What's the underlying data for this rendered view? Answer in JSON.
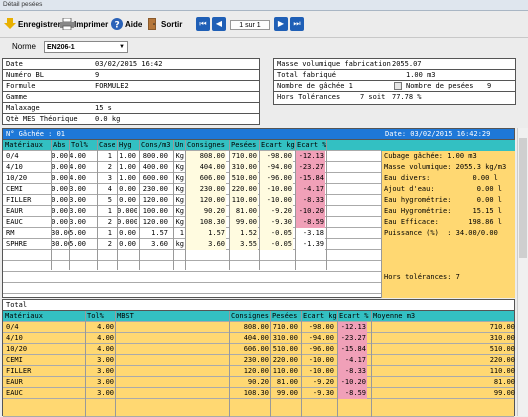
{
  "window": {
    "title": "Détail pesées"
  },
  "toolbar": {
    "save": "Enregistrer",
    "print": "Imprimer",
    "help": "Aide",
    "exit": "Sortir",
    "page": "1 sur 1"
  },
  "form": {
    "label": "Norme",
    "value": "EN206-1"
  },
  "info_left": [
    [
      "Date",
      "03/02/2015 16:42"
    ],
    [
      "Numéro BL",
      "9"
    ],
    [
      "Formule",
      "FORMULE2"
    ],
    [
      "Gamme",
      ""
    ],
    [
      "Malaxage",
      "15 s"
    ],
    [
      "Qtè MES Théorique",
      "0.0 kg"
    ]
  ],
  "info_right": {
    "masse_label": "Masse volumique fabrication",
    "masse_value": "2055.07",
    "total_label": "Total fabriqué",
    "total_value": "1.00 m3",
    "gachee_label": "Nombre de gâchée 1",
    "pesees_label": "Nombre de pesées",
    "pesees_value": "9",
    "hors_label": "Hors Tolérances",
    "hors_value": "7 soit",
    "hors_pct": "77.78 %"
  },
  "batch": {
    "title": "N° Gâchée : 01",
    "date": "Date: 03/02/2015 16:42:29",
    "headers": [
      "Matériaux",
      "Abs",
      "Tol%",
      "Case",
      "Hyg",
      "Cons/m3",
      "Un",
      "Consignes",
      "Pesées",
      "Ecart kg",
      "Ecart %"
    ],
    "rows": [
      [
        "0/4",
        "0.00",
        "4.00",
        "1",
        "1.00",
        "800.00",
        "Kg",
        "808.00",
        "710.00",
        "-98.00",
        "-12.13"
      ],
      [
        "4/10",
        "0.00",
        "4.00",
        "2",
        "1.00",
        "400.00",
        "Kg",
        "404.00",
        "310.00",
        "-94.00",
        "-23.27"
      ],
      [
        "10/20",
        "0.00",
        "4.00",
        "3",
        "1.00",
        "600.00",
        "Kg",
        "606.00",
        "510.00",
        "-96.00",
        "-15.84"
      ],
      [
        "CEMI",
        "0.00",
        "3.00",
        "4",
        "0.00",
        "230.00",
        "Kg",
        "230.00",
        "220.00",
        "-10.00",
        "-4.17"
      ],
      [
        "FILLER",
        "0.00",
        "3.00",
        "5",
        "0.00",
        "120.00",
        "Kg",
        "120.00",
        "110.00",
        "-10.00",
        "-8.33"
      ],
      [
        "EAUR",
        "0.00",
        "3.00",
        "1",
        "0.000",
        "100.00",
        "Kg",
        "90.20",
        "81.00",
        "-9.20",
        "-10.20"
      ],
      [
        "EAUC",
        "0.00",
        "3.00",
        "2",
        "0.000",
        "120.00",
        "Kg",
        "108.30",
        "99.00",
        "-9.30",
        "-8.59"
      ],
      [
        "RM",
        "30.00",
        "5.00",
        "1",
        "0.00",
        "1.57",
        "1",
        "1.57",
        "1.52",
        "-0.05",
        "-3.18"
      ],
      [
        "SPHRE",
        "30.00",
        "5.00",
        "2",
        "0.00",
        "3.60",
        "kg",
        "3.60",
        "3.55",
        "-0.05",
        "-1.39"
      ]
    ],
    "side": [
      "Cubage gâchée: 1.00 m3",
      "Masse volumique: 2055.3 kg/m3",
      "Eau divers:          0.00 l",
      "Ajout d'eau:          0.00 l",
      "Eau hygrométrie:      0.00 l",
      "Eau Hygrométrie:     15.15 l",
      "Eau Efficace:       198.86 l",
      "Puissance (%)  : 34.00/0.00"
    ],
    "hors": "Hors tolérances: 7"
  },
  "total": {
    "title": "Total",
    "headers": [
      "Matériaux",
      "Tol%",
      "MBST",
      "Consignes",
      "Pesées",
      "Ecart kg",
      "Ecart %",
      "Moyenne m3"
    ],
    "rows": [
      [
        "0/4",
        "4.00",
        "",
        "808.00",
        "710.00",
        "-98.00",
        "-12.13",
        "710.00"
      ],
      [
        "4/10",
        "4.00",
        "",
        "404.00",
        "310.00",
        "-94.00",
        "-23.27",
        "310.00"
      ],
      [
        "10/20",
        "4.00",
        "",
        "606.00",
        "510.00",
        "-96.00",
        "-15.84",
        "510.00"
      ],
      [
        "CEMI",
        "3.00",
        "",
        "230.00",
        "220.00",
        "-10.00",
        "-4.17",
        "220.00"
      ],
      [
        "FILLER",
        "3.00",
        "",
        "120.00",
        "110.00",
        "-10.00",
        "-8.33",
        "110.00"
      ],
      [
        "EAUR",
        "3.00",
        "",
        "90.20",
        "81.00",
        "-9.20",
        "-10.20",
        "81.00"
      ],
      [
        "EAUC",
        "3.00",
        "",
        "108.30",
        "99.00",
        "-9.30",
        "-8.59",
        "99.00"
      ]
    ]
  }
}
